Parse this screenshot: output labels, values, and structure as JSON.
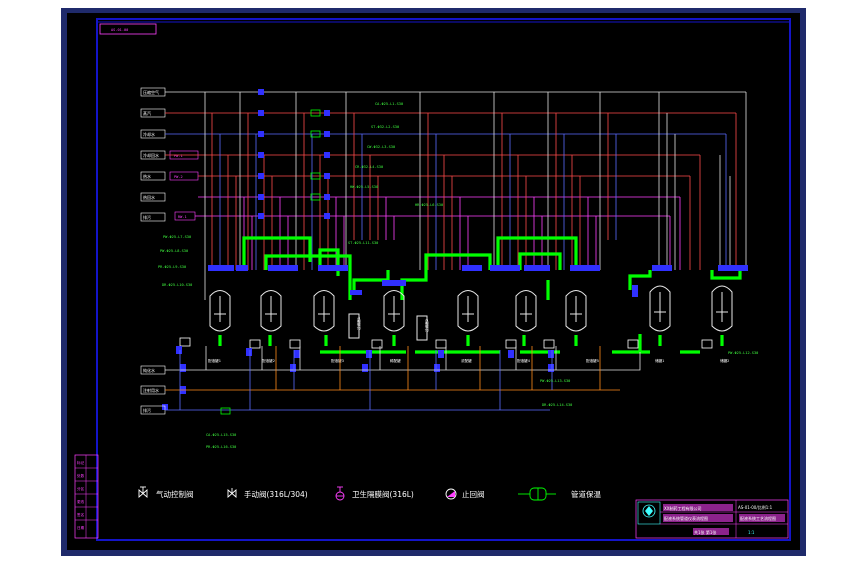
{
  "drawing": {
    "drawing_no": "AS-01-00",
    "colors": {
      "page": "#ffffff",
      "frame_fill": "#000000",
      "frame_outer": "#1f2a6b",
      "border": "#1414c8",
      "pipe_air": "#e0e0e0",
      "pipe_red": "#ff4a4a",
      "pipe_blue": "#5a6cff",
      "pipe_magenta": "#ff40ff",
      "pipe_green": "#00ff00",
      "pipe_orange": "#ff8a1a",
      "valve": "#3030ff",
      "tank": "#e8e8e8",
      "text_white": "#ffffff",
      "text_green": "#40ff40",
      "text_magenta": "#ff40ff",
      "text_cyan": "#40ffff"
    }
  },
  "header_lines": {
    "labels": [
      "压缩空气",
      "蒸汽",
      "冷却水",
      "冷却回水",
      "热水",
      "热回水",
      "排污"
    ],
    "tags": [
      "",
      "",
      "",
      "",
      "PW-1",
      "PW-2",
      "RW-1"
    ]
  },
  "line_labels": {
    "top": [
      "CA-Φ25-L1-S30",
      "ST-Φ32-L2-S30",
      "CW-Φ32-L3-S30",
      "CR-Φ32-L4-S30",
      "HW-Φ25-L5-S30",
      "HR-Φ25-L6-S30"
    ],
    "left": [
      "PW-Φ25-L7-S30",
      "PW-Φ25-L8-S30",
      "PR-Φ25-L9-S30",
      "DR-Φ25-L10-S30"
    ],
    "mid": [
      "ST-Φ25-L11-S30"
    ],
    "right": [
      "PW-Φ25-L12-S30"
    ],
    "bottom": [
      "PW-Φ25-L13-S30",
      "DR-Φ25-L14-S30",
      "CA-Φ25-L15-S30",
      "PR-Φ25-L16-S30"
    ]
  },
  "bottom_headers": {
    "labels": [
      "纯化水",
      "注射用水",
      "排污",
      "回水"
    ]
  },
  "equipment": {
    "tanks": [
      "配液罐1",
      "配液罐2",
      "配液罐3",
      "稀配罐",
      "浓配罐",
      "配液罐4",
      "配液罐5",
      "储罐1",
      "储罐2"
    ],
    "filters": [
      "过滤器1",
      "过滤器2"
    ]
  },
  "legend": {
    "items": [
      {
        "icon": "pneumatic-valve-icon",
        "label": "气动控制阀"
      },
      {
        "icon": "manual-valve-icon",
        "label": "手动阀(316L/304)"
      },
      {
        "icon": "sanitary-diaphragm-valve-icon",
        "label": "卫生隔膜阀(316L)"
      },
      {
        "icon": "check-valve-icon",
        "label": "止回阀"
      },
      {
        "icon": "pipe-reducer-icon",
        "label": "管道保温"
      }
    ]
  },
  "revision_block": {
    "labels": [
      "标记",
      "处数",
      "分区",
      "更改",
      "签名",
      "日期"
    ]
  },
  "title_block": {
    "company": "XX制药工程有限公司",
    "project": "配液系统管道仪表流程图",
    "scale": "AS-01-00/比例1:1",
    "drawing_title": "配液系统工艺流程图",
    "sheet": "共1张 第1张",
    "code": "1:1"
  }
}
